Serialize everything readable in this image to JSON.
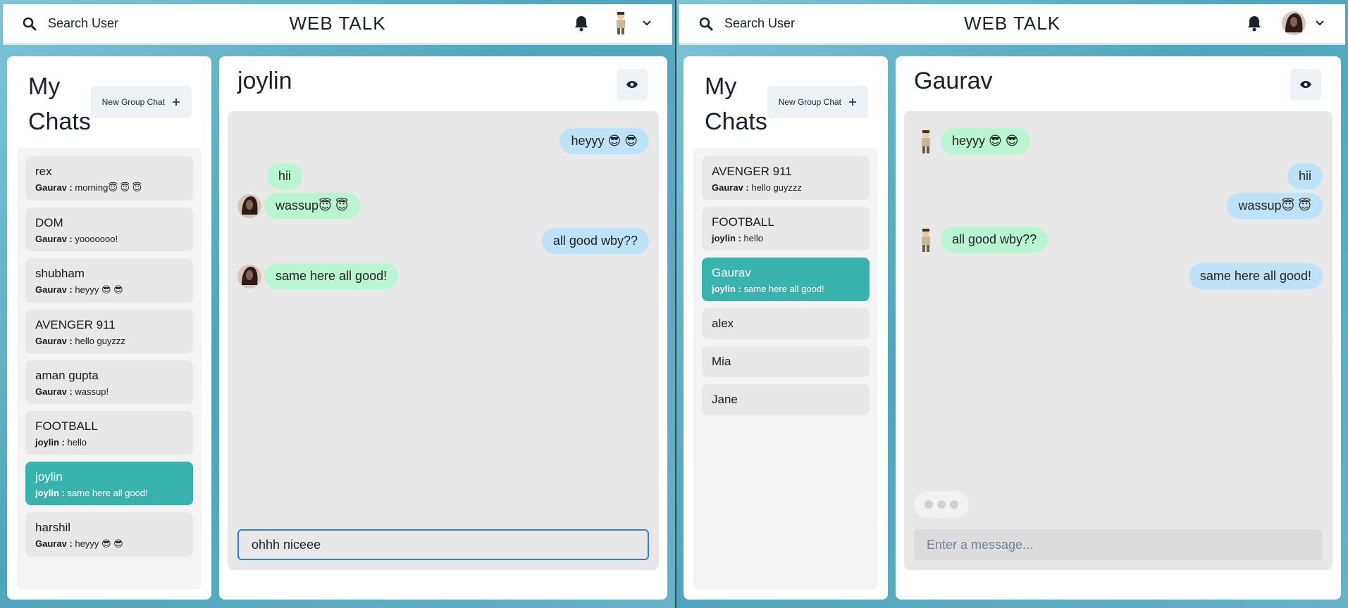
{
  "left_window": {
    "header": {
      "search_label": "Search User",
      "brand": "WEB TALK",
      "avatar": "man-cartoon-avatar"
    },
    "sidebar": {
      "title_line1": "My",
      "title_line2": "Chats",
      "new_group_label": "New Group Chat",
      "chats": [
        {
          "name": "rex",
          "sender": "Gaurav :",
          "message": "morning😇 😇 😇"
        },
        {
          "name": "DOM",
          "sender": "Gaurav :",
          "message": "yooooooo!"
        },
        {
          "name": "shubham",
          "sender": "Gaurav :",
          "message": "heyyy 😎 😎"
        },
        {
          "name": "AVENGER 911",
          "sender": "Gaurav :",
          "message": "hello guyzzz"
        },
        {
          "name": "aman gupta",
          "sender": "Gaurav :",
          "message": "wassup!"
        },
        {
          "name": "FOOTBALL",
          "sender": "joylin :",
          "message": "hello"
        },
        {
          "name": "joylin",
          "sender": "joylin :",
          "message": "same here all good!"
        },
        {
          "name": "harshil",
          "sender": "Gaurav :",
          "message": "heyyy 😎 😎"
        }
      ],
      "active_index": 6
    },
    "chat": {
      "title": "joylin",
      "messages": [
        {
          "text": "heyyy 😎 😎",
          "side": "sent"
        },
        {
          "text": "hii",
          "side": "received"
        },
        {
          "text": "wassup😇 😇",
          "side": "received"
        },
        {
          "text": "all good wby??",
          "side": "sent"
        },
        {
          "text": "same here all good!",
          "side": "received"
        }
      ],
      "input_value": "ohhh niceee"
    }
  },
  "right_window": {
    "header": {
      "search_label": "Search User",
      "brand": "WEB TALK",
      "avatar": "woman-photo-avatar"
    },
    "sidebar": {
      "title_line1": "My",
      "title_line2": "Chats",
      "new_group_label": "New Group Chat",
      "chats": [
        {
          "name": "AVENGER 911",
          "sender": "Gaurav :",
          "message": "hello guyzzz"
        },
        {
          "name": "FOOTBALL",
          "sender": "joylin :",
          "message": "hello"
        },
        {
          "name": "Gaurav",
          "sender": "joylin :",
          "message": "same here all good!"
        },
        {
          "name": "alex"
        },
        {
          "name": "Mia"
        },
        {
          "name": "Jane"
        }
      ],
      "active_index": 2
    },
    "chat": {
      "title": "Gaurav",
      "messages": [
        {
          "text": "heyyy 😎 😎",
          "side": "received"
        },
        {
          "text": "hii",
          "side": "sent"
        },
        {
          "text": "wassup😇 😇",
          "side": "sent"
        },
        {
          "text": "all good wby??",
          "side": "received"
        },
        {
          "text": "same here all good!",
          "side": "sent"
        }
      ],
      "input_placeholder": "Enter a message..."
    }
  },
  "colors": {
    "active_chat": "#38b2ac",
    "sent_bubble": "#bee3f8",
    "received_bubble": "#b9f5d0",
    "focus_border": "#3182ce"
  }
}
